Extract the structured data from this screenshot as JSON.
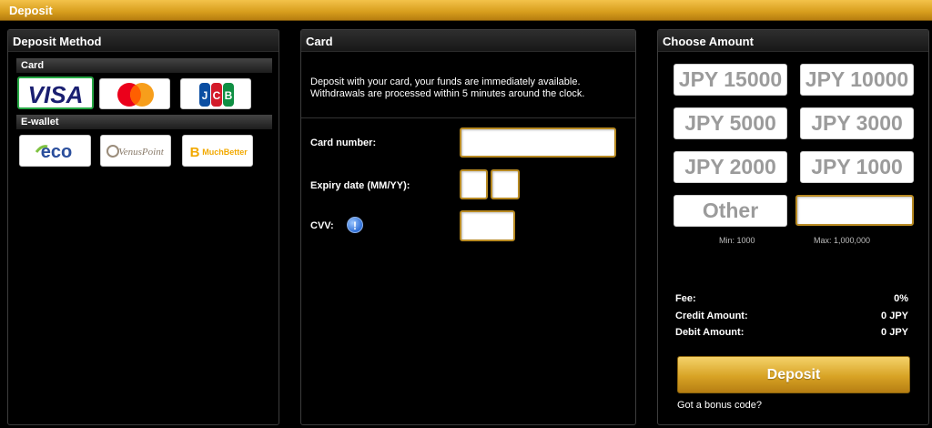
{
  "header": {
    "title": "Deposit"
  },
  "method_panel": {
    "title": "Deposit Method",
    "card_section": "Card",
    "card_methods": [
      "VISA",
      "mastercard",
      "JCB"
    ],
    "ewallet_section": "E-wallet",
    "ewallet_methods": [
      "eco",
      "VenusPoint",
      "MuchBetter"
    ]
  },
  "card_panel": {
    "title": "Card",
    "description": "Deposit with your card, your funds are immediately available. Withdrawals are processed within 5 minutes around the clock.",
    "card_number_label": "Card number:",
    "expiry_label": "Expiry date (MM/YY):",
    "cvv_label": "CVV:",
    "info_glyph": "!"
  },
  "amount_panel": {
    "title": "Choose Amount",
    "amounts": [
      "JPY 15000",
      "JPY 10000",
      "JPY 5000",
      "JPY 3000",
      "JPY 2000",
      "JPY 1000"
    ],
    "other_label": "Other",
    "min_note": "Min: 1000",
    "max_note": "Max: 1,000,000",
    "fee_label": "Fee:",
    "fee_value": "0%",
    "credit_label": "Credit Amount:",
    "credit_value": "0 JPY",
    "debit_label": "Debit Amount:",
    "debit_value": "0 JPY",
    "deposit_button": "Deposit",
    "bonus_link": "Got a bonus code?"
  },
  "colors": {
    "accent_gold": "#d8a325",
    "selected_green": "#27a845"
  }
}
